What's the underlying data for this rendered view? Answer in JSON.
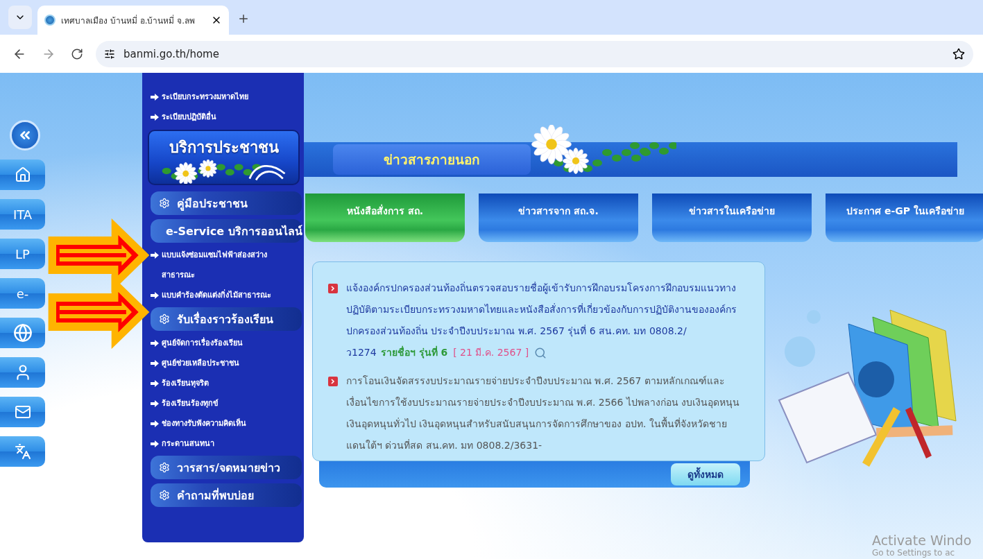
{
  "browser": {
    "tab_title": "เทศบาลเมือง บ้านหมี่ อ.บ้านหมี่ จ.ลพ",
    "url": "banmi.go.th/home"
  },
  "rail": [
    {
      "kind": "collapse"
    },
    {
      "kind": "home"
    },
    {
      "kind": "text",
      "label": "ITA"
    },
    {
      "kind": "text",
      "label": "LP"
    },
    {
      "kind": "text",
      "label": "e-"
    },
    {
      "kind": "globe"
    },
    {
      "kind": "person"
    },
    {
      "kind": "mail"
    },
    {
      "kind": "translate"
    }
  ],
  "sidebar": {
    "items": [
      {
        "kind": "link",
        "label": "ระเบียบกระทรวงมหาดไทย"
      },
      {
        "kind": "link",
        "label": "ระเบียบปฏิบัติอื่น"
      },
      {
        "kind": "banner",
        "label": "บริการประชาชน"
      },
      {
        "kind": "section",
        "label": "คู่มือประชาชน"
      },
      {
        "kind": "section",
        "label": "e-Service บริการออนไลน์"
      },
      {
        "kind": "link",
        "label": "แบบแจ้งซ่อมแซมไฟฟ้าส่องสว่างสาธารณะ"
      },
      {
        "kind": "link",
        "label": "แบบคำร้องตัดแต่งกิ่งไม้สาธารณะ"
      },
      {
        "kind": "section",
        "label": "รับเรื่องราวร้องเรียน"
      },
      {
        "kind": "link",
        "label": "ศูนย์จัดการเรื่องร้องเรียน"
      },
      {
        "kind": "link",
        "label": "ศูนย์ช่วยเหลือประชาชน"
      },
      {
        "kind": "link",
        "label": "ร้องเรียนทุจริต"
      },
      {
        "kind": "link",
        "label": "ร้องเรียนร้องทุกข์"
      },
      {
        "kind": "link",
        "label": "ช่องทางรับฟังความคิดเห็น"
      },
      {
        "kind": "link",
        "label": "กระดานสนทนา"
      },
      {
        "kind": "section",
        "label": "วารสาร/จดหมายข่าว"
      },
      {
        "kind": "section",
        "label": "คำถามที่พบบ่อย"
      }
    ]
  },
  "external_news": {
    "title": "ข่าวสารภายนอก",
    "tabs": [
      {
        "label": "หนังสือสั่งการ สถ.",
        "selected": true
      },
      {
        "label": "ข่าวสารจาก สถ.จ.",
        "selected": false
      },
      {
        "label": "ข่าวสารในเครือข่าย",
        "selected": false
      },
      {
        "label": "ประกาศ e-GP ในเครือข่าย",
        "selected": false
      }
    ],
    "news": [
      {
        "kind": "featured",
        "text": "แจ้งองค์กรปกครองส่วนท้องถิ่นตรวจสอบรายชื่อผู้เข้ารับการฝึกอบรมโครงการฝึกอบรมแนวทางปฏิบัติตามระเบียบกระทรวงมหาดไทยและหนังสือสั่งการที่เกี่ยวข้องกับการปฏิบัติงานขององค์กรปกครองส่วนท้องถิ่น ประจำปีงบประมาณ พ.ศ. 2567 รุ่นที่ 6 สน.คท. มท 0808.2/ว1274",
        "link": "รายชื่อฯ รุ่นที่ 6",
        "date": "[ 21 มี.ค. 2567 ]"
      },
      {
        "kind": "normal",
        "text": "การโอนเงินจัดสรรงบประมาณรายจ่ายประจำปีงบประมาณ พ.ศ. 2567 ตามหลักเกณฑ์และเงื่อนไขการใช้งบประมาณรายจ่ายประจำปีงบประมาณ พ.ศ. 2566 ไปพลางก่อน งบเงินอุดหนุน เงินอุดหนุนทั่วไป เงินอุดหนุนสำหรับสนับสนุนการจัดการศึกษาของ อปท. ในพื้นที่จังหวัดชายแดนใต้ฯ ด่วนที่สด สน.คท. มท 0808.2/3631-"
      }
    ],
    "view_all": "ดูทั้งหมด"
  },
  "os_notice": {
    "title": "Activate Windo",
    "subtitle": "Go to Settings to ac"
  }
}
